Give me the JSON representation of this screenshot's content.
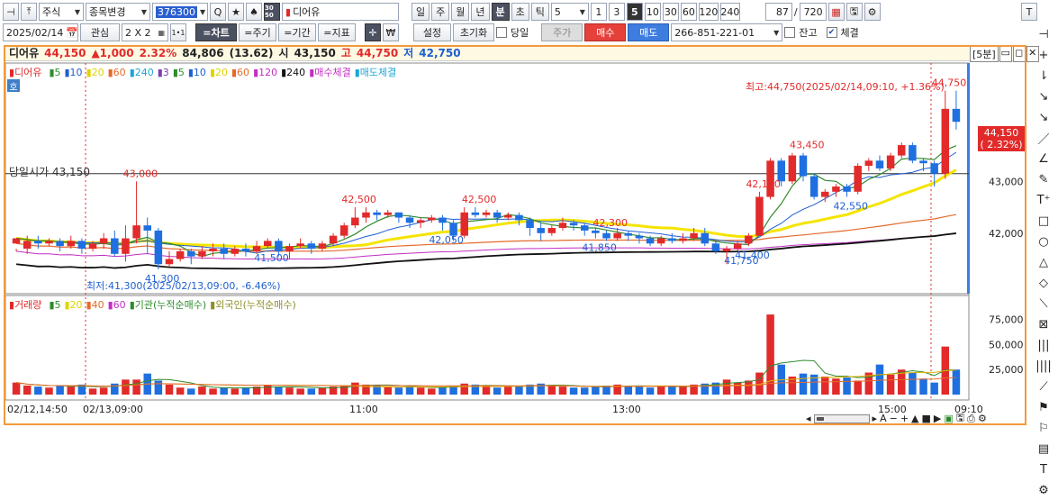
{
  "toolbar1": {
    "pin": "⊣",
    "up": "⤒",
    "type": "주식",
    "code_btn": "종목변경",
    "code": "376300",
    "search": "Q",
    "star": "★",
    "triangle": "♠",
    "mini": "30 50",
    "stock_name": "디어유",
    "periods": [
      "일",
      "주",
      "월",
      "년",
      "분",
      "초",
      "틱"
    ],
    "active_period": "분",
    "period_value": "5",
    "quick": [
      "1",
      "3",
      "5",
      "10",
      "30",
      "60",
      "120",
      "240"
    ],
    "active_quick": "5",
    "count_shown": "87",
    "count_total": "720",
    "sep": "/",
    "right_btn": "T"
  },
  "toolbar2": {
    "date": "2025/02/14",
    "group": "관심",
    "layout": "2 X 2",
    "one": "1•1",
    "tabs": [
      "=차트",
      "=주기",
      "=기간",
      "=지표"
    ],
    "active_tab": "=차트",
    "cross": "✛",
    "won": "₩",
    "settings": "설정",
    "reset": "초기화",
    "same_day": "당일",
    "same_day_checked": false,
    "stockbtn": "주가",
    "buy": "매수",
    "sell": "매도",
    "account": "266-851-221-01",
    "balance": "잔고",
    "balance_checked": false,
    "filled": "체결",
    "filled_checked": true
  },
  "info": {
    "name": "디어유",
    "price": "44,150",
    "change": "▲1,000",
    "pct": "2.32%",
    "volume": "84,806",
    "vol_pct": "(13.62)",
    "open_label": "시",
    "open": "43,150",
    "high_label": "고",
    "high": "44,750",
    "low_label": "저",
    "low": "42,750",
    "interval": "[5분]"
  },
  "price_legend": {
    "name": "디어유",
    "items": [
      {
        "t": "5",
        "c": "#2e8b2e"
      },
      {
        "t": "10",
        "c": "#1f5fd0"
      },
      {
        "t": "20",
        "c": "#e0d400"
      },
      {
        "t": "60",
        "c": "#e46a2a"
      },
      {
        "t": "240",
        "c": "#1fa5d8"
      },
      {
        "t": "3",
        "c": "#7a3fb0"
      },
      {
        "t": "5",
        "c": "#2e8b2e"
      },
      {
        "t": "10",
        "c": "#1f5fd0"
      },
      {
        "t": "20",
        "c": "#e0d400"
      },
      {
        "t": "60",
        "c": "#e46a2a"
      },
      {
        "t": "120",
        "c": "#c22fc2"
      },
      {
        "t": "240",
        "c": "#111"
      },
      {
        "t": "매수체결",
        "c": "#c22fc2"
      },
      {
        "t": "매도체결",
        "c": "#1fa5d8"
      }
    ],
    "ho": "호"
  },
  "vol_legend": {
    "name": "거래량",
    "items": [
      {
        "t": "5",
        "c": "#2e8b2e"
      },
      {
        "t": "20",
        "c": "#e0d400"
      },
      {
        "t": "40",
        "c": "#e46a2a"
      },
      {
        "t": "60",
        "c": "#c22fc2"
      },
      {
        "t": "기관(누적순매수)",
        "c": "#2e8b2e"
      },
      {
        "t": "외국인(누적순매수)",
        "c": "#8f8f2a"
      }
    ]
  },
  "annotations": {
    "open_line": "당일시가 43,150",
    "high_note": "최고:44,750(2025/02/14,09:10, +1.36%)",
    "low_note": "최저:41,300(2025/02/13,09:00, -6.46%)",
    "peaks": [
      "43,000",
      "42,500",
      "42,500",
      "42,300",
      "42,100",
      "43,450",
      "44,750"
    ],
    "troughs": [
      "41,300",
      "41,500",
      "42,050",
      "41,850",
      "41,750",
      "41,400",
      "42,550"
    ],
    "cur_price": "44,150",
    "cur_pct": "( 2.32%)"
  },
  "chart_data": {
    "type": "candlestick",
    "price_axis": [
      "43,000",
      "42,000"
    ],
    "price_ylim": [
      40900,
      45250
    ],
    "volume_axis": [
      "75,000",
      "50,000",
      "25,000"
    ],
    "volume_ylim": [
      0,
      90000
    ],
    "x_labels": [
      "02/12,14:50",
      "02/13,09:00",
      "11:00",
      "13:00",
      "15:00",
      "09:10"
    ],
    "open_price": 43150,
    "high": 44750,
    "low": 41300,
    "candles": [
      [
        41800,
        41900,
        41700,
        41650
      ],
      [
        41700,
        41850,
        41950,
        41600
      ],
      [
        41850,
        41800,
        41950,
        41700
      ],
      [
        41800,
        41850,
        41900,
        41750
      ],
      [
        41850,
        41750,
        41900,
        41650
      ],
      [
        41750,
        41850,
        41950,
        41700
      ],
      [
        41850,
        41700,
        41900,
        41600
      ],
      [
        41700,
        41800,
        41850,
        41650
      ],
      [
        41800,
        41900,
        42000,
        41700
      ],
      [
        41900,
        41600,
        42050,
        41550
      ],
      [
        41600,
        41900,
        42150,
        41450
      ],
      [
        41900,
        42150,
        43000,
        41800
      ],
      [
        42150,
        42050,
        42300,
        41600
      ],
      [
        42050,
        41400,
        42100,
        41300
      ],
      [
        41400,
        41500,
        41650,
        41350
      ],
      [
        41500,
        41650,
        41700,
        41450
      ],
      [
        41650,
        41550,
        41700,
        41400
      ],
      [
        41550,
        41650,
        41750,
        41500
      ],
      [
        41650,
        41700,
        41800,
        41550
      ],
      [
        41700,
        41600,
        41800,
        41500
      ],
      [
        41600,
        41700,
        41750,
        41550
      ],
      [
        41700,
        41650,
        41800,
        41550
      ],
      [
        41650,
        41750,
        41850,
        41600
      ],
      [
        41750,
        41850,
        41900,
        41700
      ],
      [
        41850,
        41650,
        41900,
        41550
      ],
      [
        41650,
        41750,
        41800,
        41500
      ],
      [
        41750,
        41800,
        41900,
        41700
      ],
      [
        41800,
        41700,
        41850,
        41600
      ],
      [
        41700,
        41800,
        41850,
        41650
      ],
      [
        41800,
        41950,
        42000,
        41750
      ],
      [
        41950,
        42150,
        42200,
        41900
      ],
      [
        42150,
        42300,
        42500,
        42100
      ],
      [
        42300,
        42400,
        42500,
        42200
      ],
      [
        42400,
        42350,
        42450,
        42250
      ],
      [
        42350,
        42400,
        42450,
        42300
      ],
      [
        42400,
        42300,
        42400,
        42200
      ],
      [
        42300,
        42200,
        42350,
        42100
      ],
      [
        42200,
        42250,
        42300,
        42100
      ],
      [
        42250,
        42300,
        42350,
        42200
      ],
      [
        42300,
        42200,
        42350,
        42050
      ],
      [
        42200,
        41950,
        42250,
        41850
      ],
      [
        41950,
        42400,
        42500,
        41900
      ],
      [
        42400,
        42350,
        42500,
        42300
      ],
      [
        42350,
        42400,
        42450,
        42300
      ],
      [
        42400,
        42300,
        42450,
        42200
      ],
      [
        42300,
        42350,
        42400,
        42250
      ],
      [
        42350,
        42250,
        42400,
        42150
      ],
      [
        42250,
        42100,
        42300,
        41950
      ],
      [
        42100,
        42000,
        42200,
        41850
      ],
      [
        42000,
        42100,
        42150,
        41950
      ],
      [
        42100,
        42200,
        42300,
        42050
      ],
      [
        42200,
        42150,
        42250,
        42050
      ],
      [
        42150,
        42050,
        42200,
        41950
      ],
      [
        42050,
        42000,
        42100,
        41900
      ],
      [
        42000,
        41900,
        42050,
        41850
      ],
      [
        41900,
        42000,
        42100,
        41850
      ],
      [
        42000,
        41950,
        42050,
        41850
      ],
      [
        41950,
        41900,
        42000,
        41800
      ],
      [
        41900,
        41800,
        41950,
        41750
      ],
      [
        41800,
        41900,
        41950,
        41750
      ],
      [
        41900,
        41850,
        42000,
        41800
      ],
      [
        41850,
        41900,
        42000,
        41800
      ],
      [
        41900,
        42000,
        42100,
        41850
      ],
      [
        42000,
        41800,
        42100,
        41750
      ],
      [
        41800,
        41650,
        41850,
        41600
      ],
      [
        41650,
        41700,
        41750,
        41400
      ],
      [
        41700,
        41800,
        41850,
        41650
      ],
      [
        41800,
        41950,
        42000,
        41750
      ],
      [
        41950,
        42700,
        42800,
        41950
      ],
      [
        42700,
        43400,
        43450,
        42650
      ],
      [
        43400,
        43000,
        43450,
        42900
      ],
      [
        43000,
        43500,
        43550,
        42950
      ],
      [
        43500,
        43100,
        43550,
        43000
      ],
      [
        43100,
        42700,
        43150,
        42650
      ],
      [
        42700,
        42800,
        42850,
        42600
      ],
      [
        42800,
        42900,
        42950,
        42700
      ],
      [
        42900,
        42800,
        42950,
        42700
      ],
      [
        42800,
        43300,
        43350,
        42750
      ],
      [
        43300,
        43400,
        43450,
        43200
      ],
      [
        43400,
        43250,
        43500,
        43200
      ],
      [
        43250,
        43500,
        43550,
        43200
      ],
      [
        43500,
        43700,
        43750,
        43450
      ],
      [
        43700,
        43400,
        43750,
        43350
      ],
      [
        43400,
        43350,
        43450,
        43200
      ],
      [
        43350,
        43150,
        43400,
        42900
      ],
      [
        43150,
        44400,
        44750,
        43050
      ],
      [
        44400,
        44150,
        44750,
        44000
      ]
    ],
    "volumes": [
      12000,
      9000,
      8000,
      7000,
      9000,
      8000,
      10000,
      6000,
      7000,
      11000,
      15000,
      15000,
      21000,
      14000,
      10000,
      7000,
      6000,
      8000,
      6000,
      7000,
      6000,
      7000,
      8000,
      9000,
      8000,
      7000,
      6000,
      6000,
      7000,
      8000,
      9000,
      12000,
      10000,
      9000,
      8000,
      7000,
      8000,
      7000,
      6000,
      8000,
      9000,
      11000,
      10000,
      8000,
      7000,
      8000,
      9000,
      10000,
      11000,
      9000,
      8000,
      7000,
      7000,
      8000,
      9000,
      10000,
      9000,
      8000,
      7000,
      8000,
      9000,
      8000,
      10000,
      11000,
      12000,
      15000,
      12000,
      14000,
      22000,
      80000,
      30000,
      18000,
      21000,
      20000,
      18000,
      16000,
      17000,
      14000,
      22000,
      30000,
      20000,
      25000,
      22000,
      16000,
      12000,
      48000,
      25000
    ]
  },
  "scrollbar": {
    "zoom_items": [
      "A",
      "−",
      "+",
      "▲",
      "■",
      "▶"
    ]
  },
  "righttools": [
    "⊣",
    "+",
    "⇂",
    "↘",
    "↘",
    "／",
    "∠",
    "✎",
    "T⁺",
    "□",
    "○",
    "△",
    "◇",
    "⟍",
    "⊠",
    "|||",
    "||||",
    "⟋",
    "⚑",
    "⚐",
    "▤",
    "T",
    "⚙"
  ],
  "colors": {
    "up": "#e22a2a",
    "down": "#1f6fe0",
    "ma5": "#2e8b2e",
    "ma10": "#1f5fd0",
    "ma20": "#f5e400",
    "ma60": "#e46a2a",
    "ma120": "#c22fc2",
    "ma240": "#111"
  }
}
